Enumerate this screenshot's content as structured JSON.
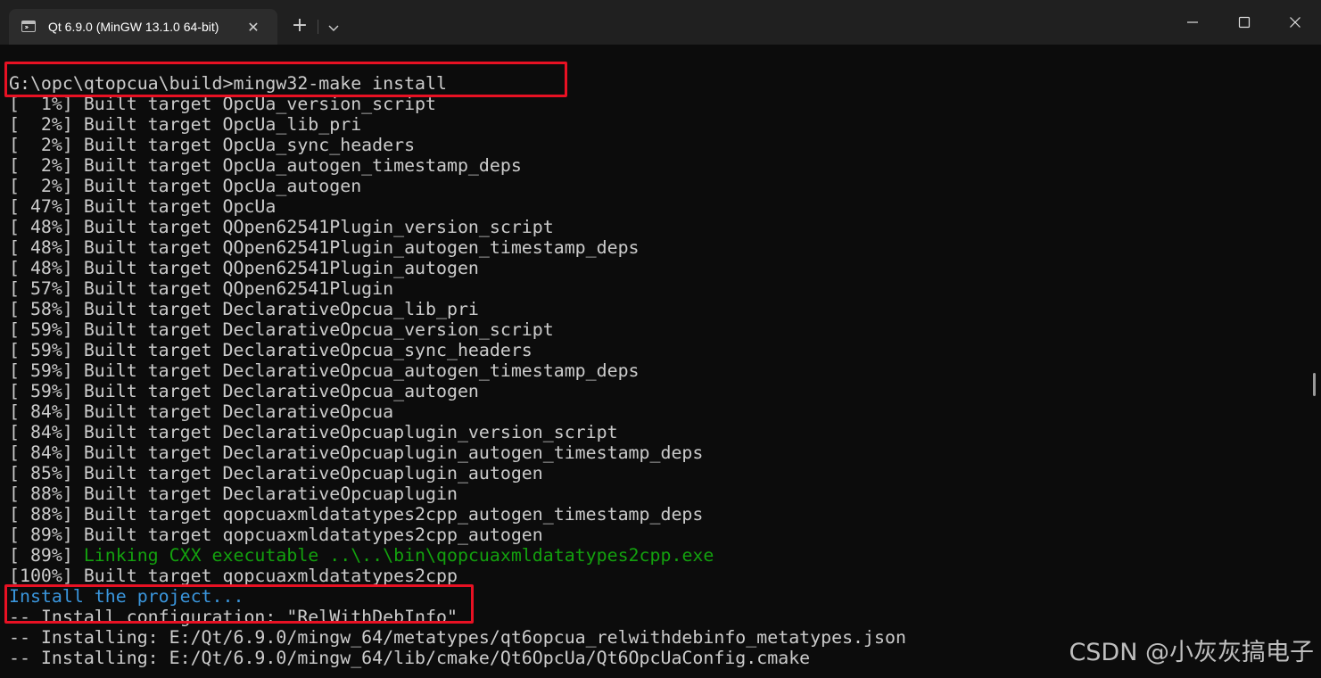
{
  "window": {
    "tab_title": "Qt 6.9.0 (MinGW 13.1.0 64-bit)",
    "tab_icon": "terminal-icon",
    "tab_close_glyph": "✕",
    "new_tab_glyph": "+",
    "dropdown_icon": "chevron-down-icon",
    "minimize_icon": "minimize-icon",
    "maximize_icon": "maximize-icon",
    "close_icon": "close-icon"
  },
  "terminal": {
    "lines": [
      {
        "text": "G:\\opc\\qtopcua\\build>mingw32-make install",
        "color": "default"
      },
      {
        "text": "[  1%] Built target OpcUa_version_script",
        "color": "default"
      },
      {
        "text": "[  2%] Built target OpcUa_lib_pri",
        "color": "default"
      },
      {
        "text": "[  2%] Built target OpcUa_sync_headers",
        "color": "default"
      },
      {
        "text": "[  2%] Built target OpcUa_autogen_timestamp_deps",
        "color": "default"
      },
      {
        "text": "[  2%] Built target OpcUa_autogen",
        "color": "default"
      },
      {
        "text": "[ 47%] Built target OpcUa",
        "color": "default"
      },
      {
        "text": "[ 48%] Built target QOpen62541Plugin_version_script",
        "color": "default"
      },
      {
        "text": "[ 48%] Built target QOpen62541Plugin_autogen_timestamp_deps",
        "color": "default"
      },
      {
        "text": "[ 48%] Built target QOpen62541Plugin_autogen",
        "color": "default"
      },
      {
        "text": "[ 57%] Built target QOpen62541Plugin",
        "color": "default"
      },
      {
        "text": "[ 58%] Built target DeclarativeOpcua_lib_pri",
        "color": "default"
      },
      {
        "text": "[ 59%] Built target DeclarativeOpcua_version_script",
        "color": "default"
      },
      {
        "text": "[ 59%] Built target DeclarativeOpcua_sync_headers",
        "color": "default"
      },
      {
        "text": "[ 59%] Built target DeclarativeOpcua_autogen_timestamp_deps",
        "color": "default"
      },
      {
        "text": "[ 59%] Built target DeclarativeOpcua_autogen",
        "color": "default"
      },
      {
        "text": "[ 84%] Built target DeclarativeOpcua",
        "color": "default"
      },
      {
        "text": "[ 84%] Built target DeclarativeOpcuaplugin_version_script",
        "color": "default"
      },
      {
        "text": "[ 84%] Built target DeclarativeOpcuaplugin_autogen_timestamp_deps",
        "color": "default"
      },
      {
        "text": "[ 85%] Built target DeclarativeOpcuaplugin_autogen",
        "color": "default"
      },
      {
        "text": "[ 88%] Built target DeclarativeOpcuaplugin",
        "color": "default"
      },
      {
        "text": "[ 88%] Built target qopcuaxmldatatypes2cpp_autogen_timestamp_deps",
        "color": "default"
      },
      {
        "text": "[ 89%] Built target qopcuaxmldatatypes2cpp_autogen",
        "color": "default"
      },
      {
        "text": "[ 89%] ",
        "color": "default",
        "suffix": "Linking CXX executable ..\\..\\bin\\qopcuaxmldatatypes2cpp.exe",
        "suffix_color": "green"
      },
      {
        "text": "[100%] Built target qopcuaxmldatatypes2cpp",
        "color": "default"
      },
      {
        "text": "Install the project...",
        "color": "blue"
      },
      {
        "text": "-- Install configuration: \"RelWithDebInfo\"",
        "color": "default"
      },
      {
        "text": "-- Installing: E:/Qt/6.9.0/mingw_64/metatypes/qt6opcua_relwithdebinfo_metatypes.json",
        "color": "default"
      },
      {
        "text": "-- Installing: E:/Qt/6.9.0/mingw_64/lib/cmake/Qt6OpcUa/Qt6OpcUaConfig.cmake",
        "color": "default"
      }
    ]
  },
  "watermark": "CSDN @小灰灰搞电子",
  "colors": {
    "background": "#0c0c0c",
    "titlebar": "#202020",
    "text": "#cccccc",
    "green": "#13a10e",
    "blue": "#3a96dd",
    "highlight_box": "#e81123"
  }
}
